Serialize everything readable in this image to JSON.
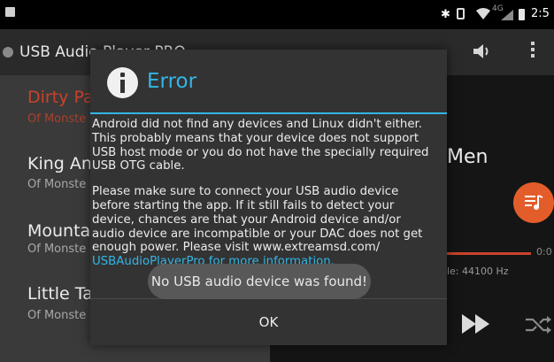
{
  "status_bar": {
    "time": "2:5",
    "network": "4G"
  },
  "app_bar": {
    "title": "USB Audio Player PRO"
  },
  "tracks": [
    {
      "title": "Dirty Pa",
      "subtitle": "Of Monste"
    },
    {
      "title": "King An",
      "subtitle": "Of Monste"
    },
    {
      "title": "Mounta",
      "subtitle": "Of Monste"
    },
    {
      "title": "Little Ta",
      "subtitle": "Of Monste"
    }
  ],
  "now_playing": {
    "title_fragment": "Men",
    "time_right": "0:0",
    "sample_rate_fragment": "le: 44100 Hz"
  },
  "dialog": {
    "title": "Error",
    "body_para1": [
      "Android did not find any devices and Linux didn't either.",
      "This probably means that your device does not support",
      "USB host mode or you do not have the specially required",
      "USB OTG cable."
    ],
    "body_para2": [
      "Please make sure to connect your USB audio device",
      "before starting the app. If it still fails to detect your",
      "device, chances are that your Android device and/or",
      "audio device are incompatible or your DAC does not get",
      "enough power. Please visit www.extreamsd.com/",
      "USBAudioPlayerPro for more information."
    ],
    "ok_label": "OK"
  },
  "toast": {
    "message": "No USB audio device was found!"
  },
  "colors": {
    "accent_blue": "#33b5e5",
    "accent_orange": "#e35d2b",
    "track_active": "#c9432a"
  }
}
